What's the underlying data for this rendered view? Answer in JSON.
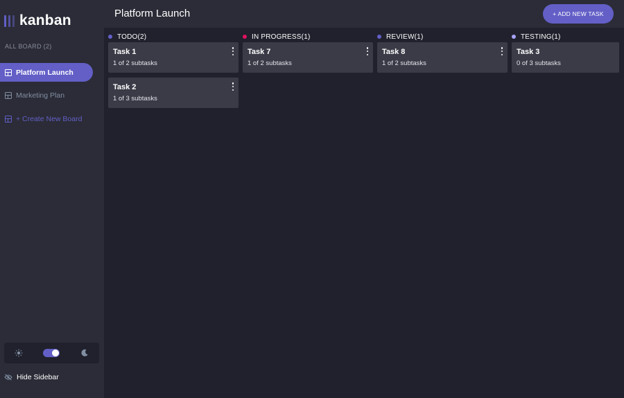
{
  "app": {
    "logo_text": "kanban"
  },
  "sidebar": {
    "all_boards_label": "ALL BOARD (2)",
    "boards": [
      {
        "label": "Platform Launch",
        "active": true
      },
      {
        "label": "Marketing Plan",
        "active": false
      }
    ],
    "create_label": "+ Create New Board",
    "hide_sidebar_label": "Hide Sidebar",
    "theme": "dark"
  },
  "header": {
    "title": "Platform Launch",
    "add_task_label": "+ ADD NEW TASK"
  },
  "columns": [
    {
      "label": "TODO(2)",
      "color": "#635fc7",
      "tasks": [
        {
          "title": "Task 1",
          "subtasks": "1 of 2 subtasks"
        },
        {
          "title": "Task 2",
          "subtasks": "1 of 3 subtasks"
        }
      ]
    },
    {
      "label": "IN PROGRESS(1)",
      "color": "#e0115f",
      "tasks": [
        {
          "title": "Task 7",
          "subtasks": "1 of 2 subtasks"
        }
      ]
    },
    {
      "label": "REVIEW(1)",
      "color": "#635fc7",
      "tasks": [
        {
          "title": "Task 8",
          "subtasks": "1 of 2 subtasks"
        }
      ]
    },
    {
      "label": "TESTING(1)",
      "color": "#a8a4ff",
      "tasks": [
        {
          "title": "Task 3",
          "subtasks": "0 of 3 subtasks"
        }
      ]
    }
  ],
  "colors": {
    "accent": "#635fc7",
    "sidebar_bg": "#2b2c37",
    "board_bg": "#20212c",
    "card_bg": "#3a3b47"
  }
}
